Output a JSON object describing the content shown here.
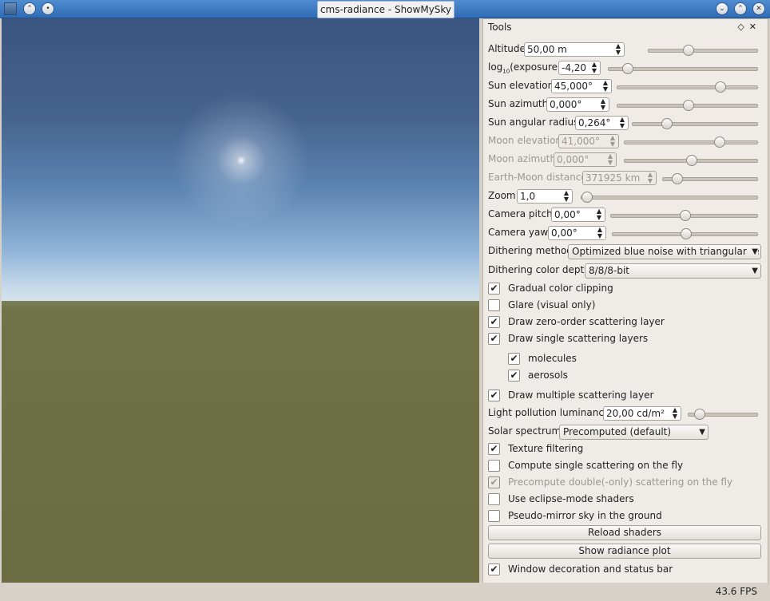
{
  "window": {
    "title": "cms-radiance - ShowMySky",
    "icons": [
      "app-icon",
      "keep-above-icon",
      "menu-icon",
      "minimize-icon",
      "maximize-icon",
      "close-icon"
    ]
  },
  "panel": {
    "title": "Tools",
    "float_glyph": "◇",
    "close_glyph": "✕"
  },
  "controls": {
    "altitude": {
      "label": "Altitude",
      "value": "50,00 m",
      "slider": 0.35
    },
    "exposure": {
      "label_pre": "log",
      "label_sub": "10",
      "label_post": "(exposure)",
      "value": "-4,20",
      "slider": 0.1
    },
    "sun_elevation": {
      "label": "Sun elevation",
      "value": "45,000°",
      "slider": 0.75
    },
    "sun_azimuth": {
      "label": "Sun azimuth",
      "value": "0,000°",
      "slider": 0.5
    },
    "sun_radius": {
      "label": "Sun angular radius",
      "value": "0,264°",
      "slider": 0.25
    },
    "moon_elevation": {
      "label": "Moon elevation",
      "value": "41,000°",
      "slider": 0.73
    },
    "moon_azimuth": {
      "label": "Moon azimuth",
      "value": "0,000°",
      "slider": 0.5
    },
    "earth_moon": {
      "label": "Earth-Moon distance",
      "value": "371925 km",
      "slider": 0.1
    },
    "zoom": {
      "label": "Zoom",
      "value": "1,0",
      "slider": 0.0
    },
    "camera_pitch": {
      "label": "Camera pitch",
      "value": "0,00°",
      "slider": 0.5
    },
    "camera_yaw": {
      "label": "Camera yaw",
      "value": "0,00°",
      "slider": 0.5
    },
    "dithering_method": {
      "label": "Dithering method",
      "value": "Optimized blue noise with triangular re"
    },
    "dithering_depth": {
      "label": "Dithering color depth",
      "value": "8/8/8-bit"
    },
    "light_pollution": {
      "label": "Light pollution luminance",
      "value": "20,00 cd/m²",
      "slider": 0.1
    },
    "solar_spectrum": {
      "label": "Solar spectrum",
      "value": "Precomputed (default)"
    }
  },
  "checks": {
    "gradual_clipping": {
      "label": "Gradual color clipping",
      "checked": "✔"
    },
    "glare": {
      "label": "Glare (visual only)",
      "checked": ""
    },
    "zero_order": {
      "label": "Draw zero-order scattering layer",
      "checked": "✔"
    },
    "single_layers": {
      "label": "Draw single scattering layers",
      "checked": "✔"
    },
    "molecules": {
      "label": "molecules",
      "checked": "✔"
    },
    "aerosols": {
      "label": "aerosols",
      "checked": "✔"
    },
    "multiple_layer": {
      "label": "Draw multiple scattering layer",
      "checked": "✔"
    },
    "texture_filtering": {
      "label": "Texture filtering",
      "checked": "✔"
    },
    "single_on_fly": {
      "label": "Compute single scattering on the fly",
      "checked": ""
    },
    "double_on_fly": {
      "label": "Precompute double(-only) scattering on the fly",
      "checked": "✔"
    },
    "eclipse_shaders": {
      "label": "Use eclipse-mode shaders",
      "checked": ""
    },
    "pseudo_mirror": {
      "label": "Pseudo-mirror sky in the ground",
      "checked": ""
    },
    "window_decoration": {
      "label": "Window decoration and status bar",
      "checked": "✔"
    }
  },
  "buttons": {
    "reload_shaders": "Reload shaders",
    "show_radiance_plot": "Show radiance plot"
  },
  "status": {
    "fps": "43.6 FPS"
  }
}
